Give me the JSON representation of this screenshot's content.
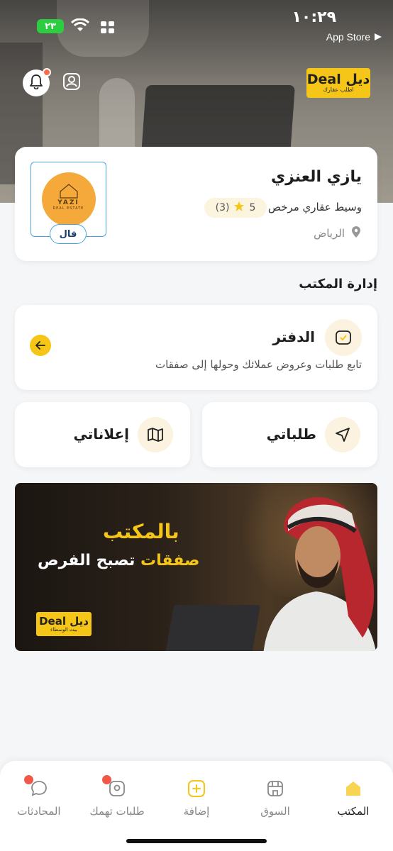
{
  "status_bar": {
    "time": "١٠:٢٩",
    "back_app": "App Store",
    "battery": "٢٣"
  },
  "header": {
    "brand_big": "Deal ديل",
    "brand_small": "اطلب عقارك"
  },
  "profile": {
    "name": "يازي العنزي",
    "role": "وسيط عقاري مرخص",
    "rating_count": "(3)",
    "rating_value": "5",
    "city": "الرياض",
    "office_logo_text": "YAZI",
    "office_logo_sub": "REAL ESTATE",
    "badge": "فال"
  },
  "office_management": {
    "title": "إدارة المكتب",
    "ledger": {
      "title": "الدفتر",
      "description": "تابع طلبات وعروض عملائك وحولها إلى صفقات"
    },
    "my_requests": "طلباتي",
    "my_ads": "إعلاناتي"
  },
  "banner": {
    "line1": "بالمكتب",
    "line2_prefix": "تصبح الفرص",
    "line2_highlight": "صفقات",
    "logo_big": "Deal ديل",
    "logo_small": "بيت الوسطاء"
  },
  "bottom_nav": {
    "office": "المكتب",
    "market": "السوق",
    "add": "إضافة",
    "requests": "طلبات تهمك",
    "chats": "المحادثات"
  },
  "colors": {
    "accent": "#f5c518",
    "notification": "#ff6a4d"
  }
}
